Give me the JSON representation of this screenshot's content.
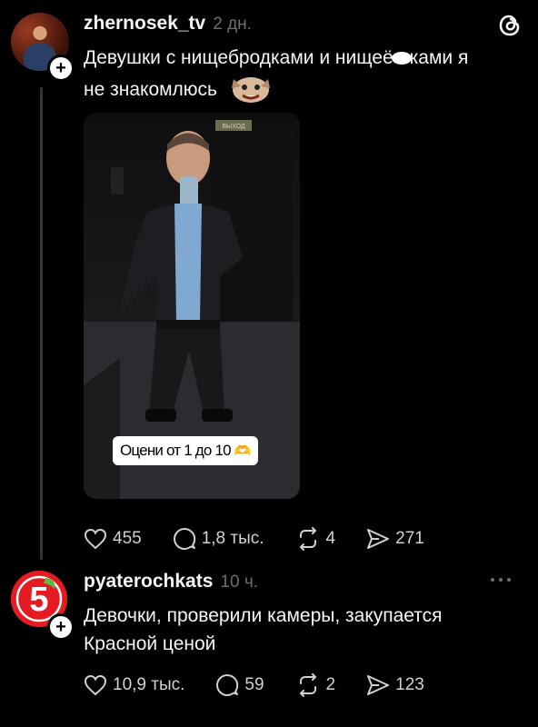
{
  "post": {
    "username": "zhernosek_tv",
    "time": "2 дн.",
    "text_line1": "Девушки с нищебродками и нищеё",
    "text_line1_end": "ками я",
    "text_line2": "не знакомлюсь",
    "photo_sticker": "Оцени от 1 до 10",
    "photo_sign": "ВЫХОД",
    "likes": "455",
    "replies": "1,8 тыс.",
    "reposts": "4",
    "shares": "271"
  },
  "reply": {
    "username": "pyaterochkats",
    "time": "10 ч.",
    "text_line1": "Девочки, проверили камеры, закупается",
    "text_line2": "Красной ценой",
    "likes": "10,9 тыс.",
    "replies": "59",
    "reposts": "2",
    "shares": "123",
    "logo_text": "5"
  },
  "icons": {
    "app": "threads-logo-icon",
    "more": "more-options-icon",
    "like": "heart-icon",
    "reply": "comment-icon",
    "repost": "repost-icon",
    "share": "share-icon",
    "follow": "plus-icon"
  },
  "colors": {
    "background": "#000000",
    "text": "#f3f5f7",
    "secondary": "#6d6d6d",
    "brand_red": "#e51b23",
    "brand_green": "#58b947"
  }
}
